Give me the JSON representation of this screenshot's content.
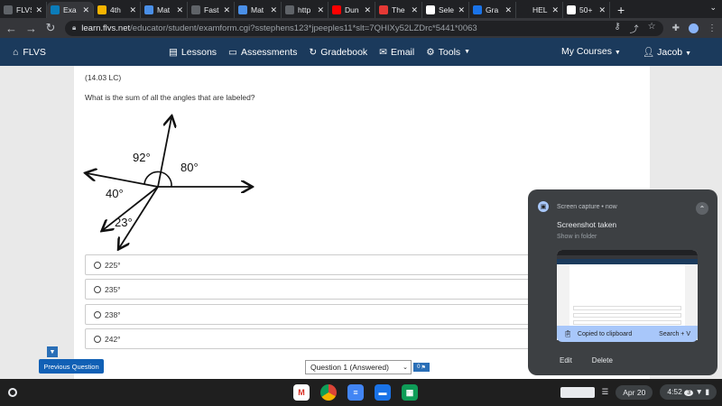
{
  "browser": {
    "tabs": [
      {
        "title": "FLVS",
        "favicon": "globe-icon",
        "color": "#5f6368",
        "active": false
      },
      {
        "title": "Exa",
        "favicon": "exam-icon",
        "color": "#0b7cba",
        "active": true
      },
      {
        "title": "4th",
        "favicon": "slides-icon",
        "color": "#f5b400",
        "active": false
      },
      {
        "title": "Mat",
        "favicon": "doc-icon",
        "color": "#4a8fe7",
        "active": false
      },
      {
        "title": "Fast",
        "favicon": "globe-icon",
        "color": "#5f6368",
        "active": false
      },
      {
        "title": "Mat",
        "favicon": "doc-icon",
        "color": "#4a8fe7",
        "active": false
      },
      {
        "title": "http",
        "favicon": "globe-icon",
        "color": "#5f6368",
        "active": false
      },
      {
        "title": "Dun",
        "favicon": "youtube-icon",
        "color": "#ff0000",
        "active": false
      },
      {
        "title": "The",
        "favicon": "x-box-icon",
        "color": "#e53935",
        "active": false
      },
      {
        "title": "Sele",
        "favicon": "google-icon",
        "color": "#ffffff",
        "active": false
      },
      {
        "title": "Gra",
        "favicon": "globe-icon",
        "color": "#1a73e8",
        "active": false
      },
      {
        "title": "HEL",
        "favicon": "hash-icon",
        "color": "#202124",
        "active": false
      },
      {
        "title": "50+",
        "favicon": "google-icon",
        "color": "#ffffff",
        "active": false
      }
    ],
    "new_tab_label": "+",
    "url_host": "learn.flvs.net",
    "url_path": "/educator/student/examform.cgi?sstephens123*jpeeples11*slt=7QHIXy52LZDrc*5441*0063"
  },
  "navbar": {
    "brand": "FLVS",
    "links": [
      {
        "label": "Lessons",
        "icon": "book-icon"
      },
      {
        "label": "Assessments",
        "icon": "laptop-icon"
      },
      {
        "label": "Gradebook",
        "icon": "refresh-icon"
      },
      {
        "label": "Email",
        "icon": "envelope-icon"
      },
      {
        "label": "Tools",
        "icon": "gear-icon"
      }
    ],
    "my_courses": "My Courses",
    "user": "Jacob",
    "bg_color": "#1b3a5c"
  },
  "question": {
    "code": "(14.03 LC)",
    "prompt": "What is the sum of all the angles that are labeled?",
    "angle_labels": [
      "92°",
      "80°",
      "40°",
      "23°"
    ],
    "answers": [
      "225°",
      "235°",
      "238°",
      "242°"
    ]
  },
  "footer": {
    "prev_button": "Previous Question",
    "question_select": "Question 1 (Answered)",
    "flag_count": "0"
  },
  "notification": {
    "meta": "Screen capture • now",
    "title": "Screenshot taken",
    "subtitle": "Show in folder",
    "clipboard": "Copied to clipboard",
    "shortcut": "Search + V",
    "actions": [
      "Edit",
      "Delete"
    ]
  },
  "shelf": {
    "date": "Apr 20",
    "time": "4:52",
    "notif_count": "3"
  }
}
